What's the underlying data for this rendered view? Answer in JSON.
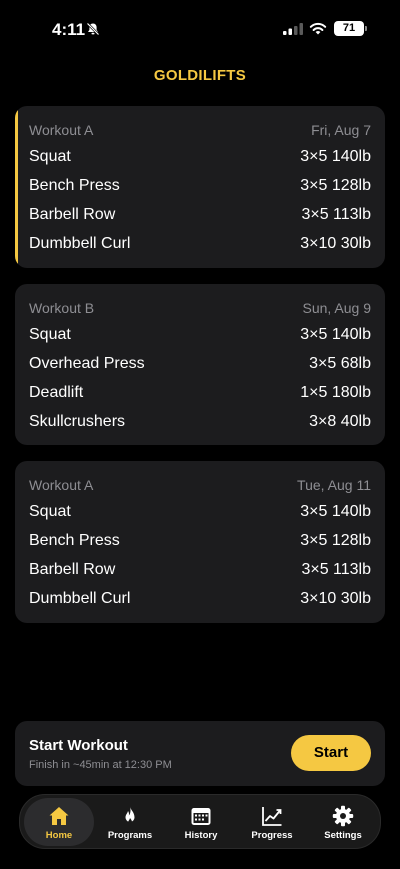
{
  "status_bar": {
    "time": "4:11",
    "battery": "71",
    "bell_icon": "bell-slash-icon",
    "signal_icon": "cellular-signal-icon",
    "wifi_icon": "wifi-icon"
  },
  "app": {
    "title": "GOLDILIFTS",
    "accent_color": "#f5c842"
  },
  "workouts": [
    {
      "name": "Workout A",
      "date": "Fri, Aug 7",
      "active": true,
      "exercises": [
        {
          "name": "Squat",
          "detail": "3×5 140lb"
        },
        {
          "name": "Bench Press",
          "detail": "3×5 128lb"
        },
        {
          "name": "Barbell Row",
          "detail": "3×5 113lb"
        },
        {
          "name": "Dumbbell Curl",
          "detail": "3×10 30lb"
        }
      ]
    },
    {
      "name": "Workout B",
      "date": "Sun, Aug 9",
      "active": false,
      "exercises": [
        {
          "name": "Squat",
          "detail": "3×5 140lb"
        },
        {
          "name": "Overhead Press",
          "detail": "3×5 68lb"
        },
        {
          "name": "Deadlift",
          "detail": "1×5 180lb"
        },
        {
          "name": "Skullcrushers",
          "detail": "3×8 40lb"
        }
      ]
    },
    {
      "name": "Workout A",
      "date": "Tue, Aug 11",
      "active": false,
      "exercises": [
        {
          "name": "Squat",
          "detail": "3×5 140lb"
        },
        {
          "name": "Bench Press",
          "detail": "3×5 128lb"
        },
        {
          "name": "Barbell Row",
          "detail": "3×5 113lb"
        },
        {
          "name": "Dumbbell Curl",
          "detail": "3×10 30lb"
        }
      ]
    }
  ],
  "start_workout": {
    "title": "Start Workout",
    "subtitle": "Finish in ~45min at 12:30 PM",
    "button_label": "Start"
  },
  "tabs": [
    {
      "label": "Home",
      "icon": "house-icon",
      "active": true
    },
    {
      "label": "Programs",
      "icon": "flame-icon",
      "active": false
    },
    {
      "label": "History",
      "icon": "calendar-icon",
      "active": false
    },
    {
      "label": "Progress",
      "icon": "chart-line-icon",
      "active": false
    },
    {
      "label": "Settings",
      "icon": "gear-icon",
      "active": false
    }
  ]
}
